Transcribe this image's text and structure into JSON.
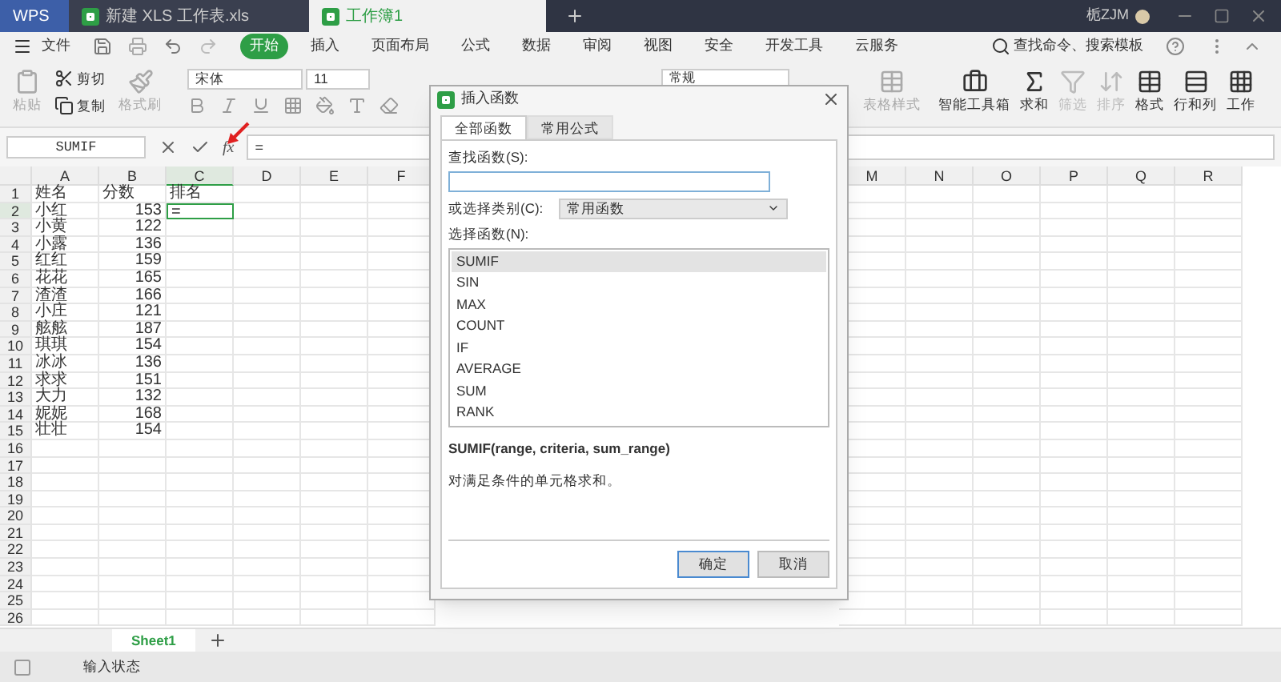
{
  "title_bar": {
    "tabs": [
      {
        "label": "WPS",
        "kind": "home",
        "selected": false
      },
      {
        "label": "新建 XLS 工作表.xls",
        "kind": "file",
        "selected": false
      },
      {
        "label": "工作簿1",
        "kind": "file",
        "selected": true
      }
    ],
    "user": "栀ZJM"
  },
  "menu": {
    "file": "文件",
    "items": [
      {
        "label": "开始",
        "selected": true
      },
      {
        "label": "插入",
        "selected": false
      },
      {
        "label": "页面布局",
        "selected": false
      },
      {
        "label": "公式",
        "selected": false
      },
      {
        "label": "数据",
        "selected": false
      },
      {
        "label": "审阅",
        "selected": false
      },
      {
        "label": "视图",
        "selected": false
      },
      {
        "label": "安全",
        "selected": false
      },
      {
        "label": "开发工具",
        "selected": false
      },
      {
        "label": "云服务",
        "selected": false
      }
    ],
    "search": "查找命令、搜索模板"
  },
  "toolbar": {
    "paste": "粘贴",
    "cut": "剪切",
    "copy": "复制",
    "format_painter": "格式刷",
    "font": "宋体",
    "font_size": "11",
    "number_format": "常规",
    "table_style": "表格样式",
    "tools": [
      {
        "label": "智能工具箱",
        "kind": "toolbox",
        "disabled": false
      },
      {
        "label": "求和",
        "kind": "sum",
        "disabled": false
      },
      {
        "label": "筛选",
        "kind": "filter",
        "disabled": true
      },
      {
        "label": "排序",
        "kind": "sort",
        "disabled": true
      },
      {
        "label": "格式",
        "kind": "format",
        "disabled": false
      },
      {
        "label": "行和列",
        "kind": "rows",
        "disabled": false
      },
      {
        "label": "工作",
        "kind": "sheet",
        "disabled": false
      }
    ]
  },
  "formula_bar": {
    "name_box": "SUMIF",
    "fx": "fx",
    "formula": "="
  },
  "sheet": {
    "columns_left": [
      "A",
      "B",
      "C",
      "D",
      "E",
      "F"
    ],
    "columns_right": [
      "M",
      "N",
      "O",
      "P",
      "Q",
      "R"
    ],
    "rows": [
      {
        "number": "1",
        "cells": [
          {
            "text": "姓名",
            "kind": "text",
            "selected": false
          },
          {
            "text": "分数",
            "kind": "text",
            "selected": false
          },
          {
            "text": "排名",
            "kind": "text",
            "selected": false
          }
        ]
      },
      {
        "number": "2",
        "cells": [
          {
            "text": "小红",
            "kind": "text",
            "selected": false
          },
          {
            "text": "153",
            "kind": "number",
            "selected": false
          },
          {
            "text": "=",
            "kind": "text",
            "selected": true
          }
        ]
      },
      {
        "number": "3",
        "cells": [
          {
            "text": "小黄",
            "kind": "text",
            "selected": false
          },
          {
            "text": "122",
            "kind": "number",
            "selected": false
          }
        ]
      },
      {
        "number": "4",
        "cells": [
          {
            "text": "小露",
            "kind": "text",
            "selected": false
          },
          {
            "text": "136",
            "kind": "number",
            "selected": false
          }
        ]
      },
      {
        "number": "5",
        "cells": [
          {
            "text": "红红",
            "kind": "text",
            "selected": false
          },
          {
            "text": "159",
            "kind": "number",
            "selected": false
          }
        ]
      },
      {
        "number": "6",
        "cells": [
          {
            "text": "花花",
            "kind": "text",
            "selected": false
          },
          {
            "text": "165",
            "kind": "number",
            "selected": false
          }
        ]
      },
      {
        "number": "7",
        "cells": [
          {
            "text": "渣渣",
            "kind": "text",
            "selected": false
          },
          {
            "text": "166",
            "kind": "number",
            "selected": false
          }
        ]
      },
      {
        "number": "8",
        "cells": [
          {
            "text": "小庄",
            "kind": "text",
            "selected": false
          },
          {
            "text": "121",
            "kind": "number",
            "selected": false
          }
        ]
      },
      {
        "number": "9",
        "cells": [
          {
            "text": "舷舷",
            "kind": "text",
            "selected": false
          },
          {
            "text": "187",
            "kind": "number",
            "selected": false
          }
        ]
      },
      {
        "number": "10",
        "cells": [
          {
            "text": "琪琪",
            "kind": "text",
            "selected": false
          },
          {
            "text": "154",
            "kind": "number",
            "selected": false
          }
        ]
      },
      {
        "number": "11",
        "cells": [
          {
            "text": "冰冰",
            "kind": "text",
            "selected": false
          },
          {
            "text": "136",
            "kind": "number",
            "selected": false
          }
        ]
      },
      {
        "number": "12",
        "cells": [
          {
            "text": "求求",
            "kind": "text",
            "selected": false
          },
          {
            "text": "151",
            "kind": "number",
            "selected": false
          }
        ]
      },
      {
        "number": "13",
        "cells": [
          {
            "text": "大力",
            "kind": "text",
            "selected": false
          },
          {
            "text": "132",
            "kind": "number",
            "selected": false
          }
        ]
      },
      {
        "number": "14",
        "cells": [
          {
            "text": "妮妮",
            "kind": "text",
            "selected": false
          },
          {
            "text": "168",
            "kind": "number",
            "selected": false
          }
        ]
      },
      {
        "number": "15",
        "cells": [
          {
            "text": "壮壮",
            "kind": "text",
            "selected": false
          },
          {
            "text": "154",
            "kind": "number",
            "selected": false
          }
        ]
      },
      {
        "number": "16"
      },
      {
        "number": "17"
      },
      {
        "number": "18"
      },
      {
        "number": "19"
      },
      {
        "number": "20"
      },
      {
        "number": "21"
      },
      {
        "number": "22"
      },
      {
        "number": "23"
      },
      {
        "number": "24"
      },
      {
        "number": "25"
      },
      {
        "number": "26"
      }
    ]
  },
  "sheet_tabs": [
    {
      "label": "Sheet1",
      "selected": true
    }
  ],
  "status_bar": {
    "text": "输入状态"
  },
  "dialog": {
    "title": "插入函数",
    "tabs": [
      {
        "label": "全部函数",
        "selected": true
      },
      {
        "label": "常用公式",
        "selected": false
      }
    ],
    "search_label": "查找函数(S):",
    "category_label": "或选择类别(C):",
    "category": "常用函数",
    "list_label": "选择函数(N):",
    "functions": [
      {
        "name": "SUMIF",
        "selected": true
      },
      {
        "name": "SIN",
        "selected": false
      },
      {
        "name": "MAX",
        "selected": false
      },
      {
        "name": "COUNT",
        "selected": false
      },
      {
        "name": "IF",
        "selected": false
      },
      {
        "name": "AVERAGE",
        "selected": false
      },
      {
        "name": "SUM",
        "selected": false
      },
      {
        "name": "RANK",
        "selected": false
      }
    ],
    "signature": "SUMIF(range, criteria, sum_range)",
    "description": "对满足条件的单元格求和。",
    "ok": "确定",
    "cancel": "取消"
  }
}
